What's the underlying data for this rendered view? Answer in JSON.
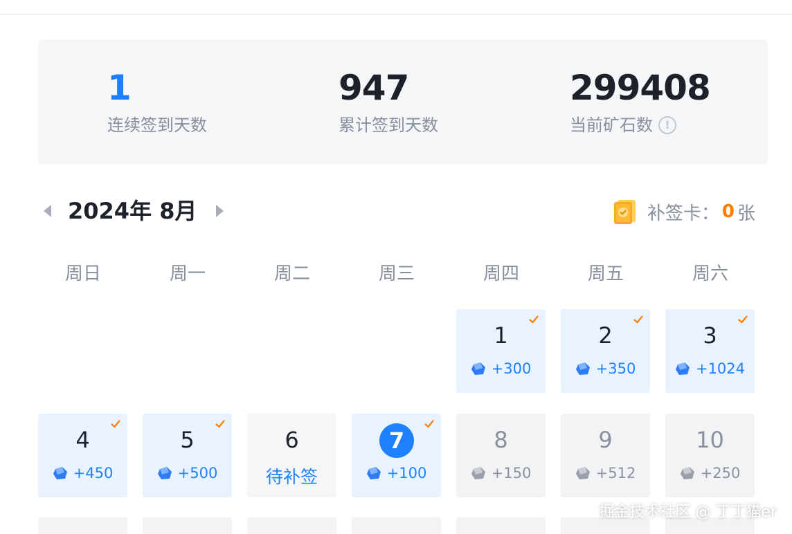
{
  "stats": {
    "streak_value": "1",
    "streak_label": "连续签到天数",
    "total_value": "947",
    "total_label": "累计签到天数",
    "ore_value": "299408",
    "ore_label": "当前矿石数",
    "info_glyph": "!"
  },
  "calendar": {
    "month_title": "2024年 8月",
    "makeup_label": "补签卡：",
    "makeup_count": "0",
    "makeup_unit": "张",
    "weekdays": [
      "周日",
      "周一",
      "周二",
      "周三",
      "周四",
      "周五",
      "周六"
    ],
    "days": [
      {
        "day": "1",
        "reward": "+300",
        "status": "signed"
      },
      {
        "day": "2",
        "reward": "+350",
        "status": "signed"
      },
      {
        "day": "3",
        "reward": "+1024",
        "status": "signed"
      },
      {
        "day": "4",
        "reward": "+450",
        "status": "signed"
      },
      {
        "day": "5",
        "reward": "+500",
        "status": "signed"
      },
      {
        "day": "6",
        "reward": "待补签",
        "status": "pending"
      },
      {
        "day": "7",
        "reward": "+100",
        "status": "today"
      },
      {
        "day": "8",
        "reward": "+150",
        "status": "future"
      },
      {
        "day": "9",
        "reward": "+512",
        "status": "future"
      },
      {
        "day": "10",
        "reward": "+250",
        "status": "future"
      }
    ]
  },
  "watermark": "掘金技术社区 @ 丁丁猫er",
  "colors": {
    "accent": "#1e80ff",
    "check": "#ff7d00",
    "signed_bg": "#e9f3ff",
    "future_bg": "#f2f3f5"
  }
}
